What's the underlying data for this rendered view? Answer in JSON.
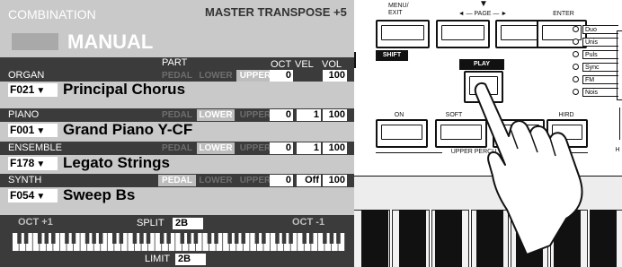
{
  "lcd": {
    "screen_title": "COMBINATION",
    "master_transpose_label": "MASTER TRANSPOSE",
    "master_transpose_value": "+5",
    "mode_value": "MANUAL",
    "header": {
      "part": "PART",
      "oct": "OCT",
      "vel": "VEL",
      "vol": "VOL"
    },
    "part_labels": {
      "pedal": "PEDAL",
      "lower": "LOWER",
      "upper": "UPPER"
    },
    "sections": [
      {
        "name": "ORGAN",
        "active_parts": [
          "upper"
        ],
        "oct": "0",
        "vel": "",
        "vol": "100",
        "patch_number": "F021",
        "patch_name": "Principal Chorus"
      },
      {
        "name": "PIANO",
        "active_parts": [
          "lower"
        ],
        "oct": "0",
        "vel": "1",
        "vol": "100",
        "patch_number": "F001",
        "patch_name": "Grand Piano Y-CF"
      },
      {
        "name": "ENSEMBLE",
        "active_parts": [
          "lower"
        ],
        "oct": "0",
        "vel": "1",
        "vol": "100",
        "patch_number": "F178",
        "patch_name": "Legato Strings"
      },
      {
        "name": "SYNTH",
        "active_parts": [
          "pedal"
        ],
        "oct": "0",
        "vel": "Off",
        "vol": "100",
        "patch_number": "F054",
        "patch_name": "Sweep Bs"
      }
    ],
    "dropdown_glyph": "▼",
    "keyboard": {
      "left_oct_label": "OCT",
      "left_oct_value": "+1",
      "split_label": "SPLIT",
      "split_value": "2B",
      "right_oct_label": "OCT",
      "right_oct_value": "-1",
      "limit_label": "LIMIT",
      "limit_value": "2B"
    }
  },
  "panel": {
    "menu_exit_label": "MENU/\nEXIT",
    "page_label": "◄ — PAGE — ►",
    "page_pointer_glyph": "▼",
    "enter_label": "ENTER",
    "shift_label": "SHIFT",
    "play_label": "PLAY",
    "on_label": "ON",
    "soft_label": "SOFT",
    "third_label": "HIRD",
    "upper_perc_label": "UPPER PERCU",
    "right_edge_label": "H",
    "synth_types": [
      "Duo",
      "Unis",
      "Puls",
      "Sync",
      "FM",
      "Nois"
    ],
    "pressing_hand_icon": "pointing-hand-icon"
  }
}
